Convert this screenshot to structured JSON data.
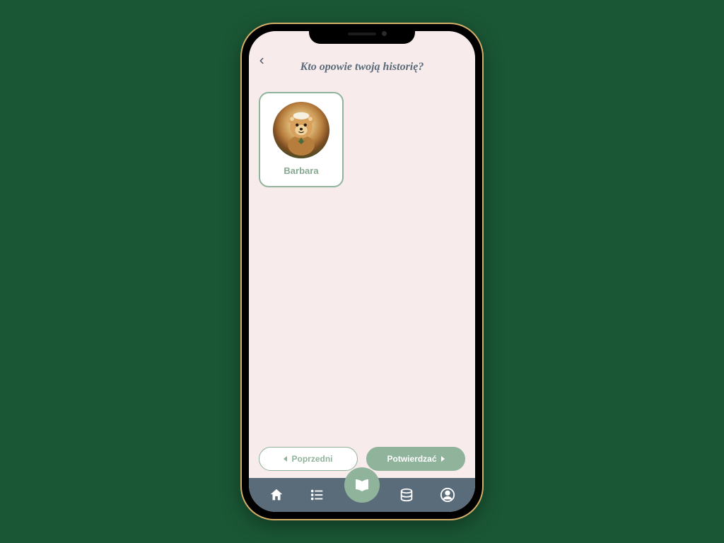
{
  "header": {
    "title": "Kto opowie twoją historię?"
  },
  "narrators": [
    {
      "name": "Barbara"
    }
  ],
  "footer": {
    "prev_label": "Poprzedni",
    "confirm_label": "Potwierdzać"
  }
}
